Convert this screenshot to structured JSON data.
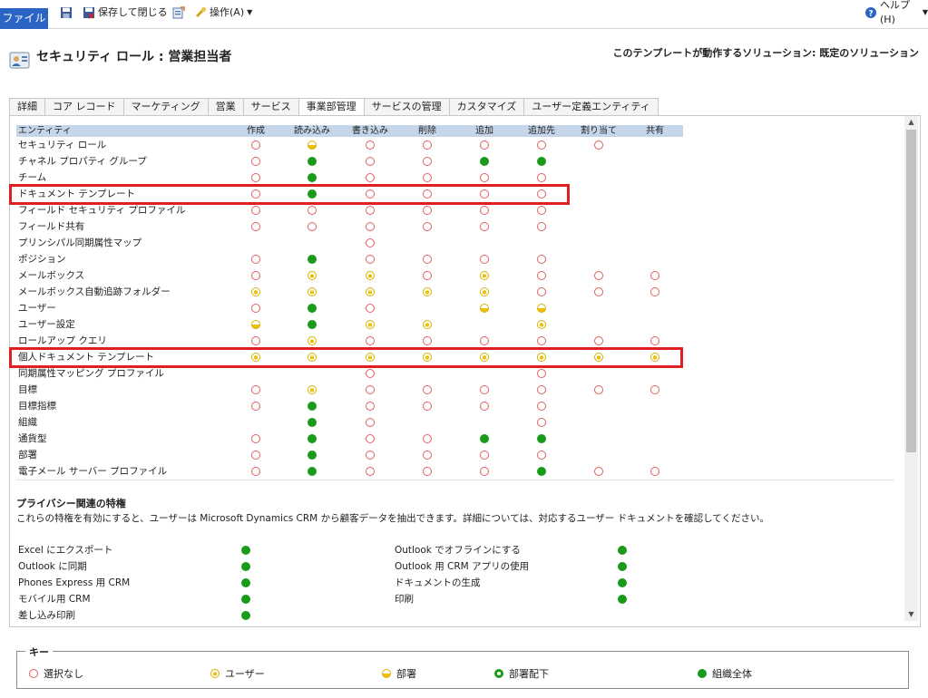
{
  "ribbon": {
    "file_label": "ファイル",
    "save_close_label": "保存して閉じる",
    "actions_label": "操作(A)",
    "help_label": "ヘルプ(H)"
  },
  "header": {
    "title": "セキュリティ ロール : 営業担当者",
    "solution": "このテンプレートが動作するソリューション: 既定のソリューション"
  },
  "tabs": [
    "詳細",
    "コア レコード",
    "マーケティング",
    "営業",
    "サービス",
    "事業部管理",
    "サービスの管理",
    "カスタマイズ",
    "ユーザー定義エンティティ"
  ],
  "active_tab": 5,
  "grid": {
    "columns": [
      "エンティティ",
      "作成",
      "読み込み",
      "書き込み",
      "削除",
      "追加",
      "追加先",
      "割り当て",
      "共有"
    ],
    "rows": [
      {
        "label": "セキュリティ ロール",
        "cells": [
          "none",
          "bu",
          "none",
          "none",
          "none",
          "none",
          "none",
          ""
        ]
      },
      {
        "label": "チャネル プロパティ グループ",
        "cells": [
          "none",
          "org",
          "none",
          "none",
          "org",
          "org",
          "",
          ""
        ]
      },
      {
        "label": "チーム",
        "cells": [
          "none",
          "org",
          "none",
          "none",
          "none",
          "none",
          "",
          ""
        ]
      },
      {
        "label": "ドキュメント テンプレート",
        "cells": [
          "none",
          "org",
          "none",
          "none",
          "none",
          "none",
          "",
          ""
        ]
      },
      {
        "label": "フィールド セキュリティ プロファイル",
        "cells": [
          "none",
          "none",
          "none",
          "none",
          "none",
          "none",
          "",
          ""
        ]
      },
      {
        "label": "フィールド共有",
        "cells": [
          "none",
          "none",
          "none",
          "none",
          "none",
          "none",
          "",
          ""
        ]
      },
      {
        "label": "プリンシパル同期属性マップ",
        "cells": [
          "",
          "",
          "none",
          "",
          "",
          "",
          "",
          ""
        ]
      },
      {
        "label": "ポジション",
        "cells": [
          "none",
          "org",
          "none",
          "none",
          "none",
          "none",
          "",
          ""
        ]
      },
      {
        "label": "メールボックス",
        "cells": [
          "none",
          "user",
          "user",
          "none",
          "user",
          "none",
          "none",
          "none"
        ]
      },
      {
        "label": "メールボックス自動追跡フォルダー",
        "cells": [
          "user",
          "user",
          "user",
          "user",
          "user",
          "none",
          "none",
          "none"
        ]
      },
      {
        "label": "ユーザー",
        "cells": [
          "none",
          "org",
          "none",
          "",
          "bu",
          "bu",
          "",
          ""
        ]
      },
      {
        "label": "ユーザー設定",
        "cells": [
          "bu",
          "org",
          "user",
          "user",
          "",
          "user",
          "",
          ""
        ]
      },
      {
        "label": "ロールアップ クエリ",
        "cells": [
          "none",
          "user",
          "none",
          "none",
          "none",
          "none",
          "none",
          "none"
        ]
      },
      {
        "label": "個人ドキュメント テンプレート",
        "cells": [
          "user",
          "user",
          "user",
          "user",
          "user",
          "user",
          "user",
          "user"
        ]
      },
      {
        "label": "同期属性マッピング プロファイル",
        "cells": [
          "",
          "",
          "none",
          "",
          "",
          "none",
          "",
          ""
        ]
      },
      {
        "label": "目標",
        "cells": [
          "none",
          "user",
          "none",
          "none",
          "none",
          "none",
          "none",
          "none"
        ]
      },
      {
        "label": "目標指標",
        "cells": [
          "none",
          "org",
          "none",
          "none",
          "none",
          "none",
          "",
          ""
        ]
      },
      {
        "label": "組織",
        "cells": [
          "",
          "org",
          "none",
          "",
          "",
          "none",
          "",
          ""
        ]
      },
      {
        "label": "通貨型",
        "cells": [
          "none",
          "org",
          "none",
          "none",
          "org",
          "org",
          "",
          ""
        ]
      },
      {
        "label": "部署",
        "cells": [
          "none",
          "org",
          "none",
          "none",
          "none",
          "none",
          "",
          ""
        ]
      },
      {
        "label": "電子メール サーバー プロファイル",
        "cells": [
          "none",
          "org",
          "none",
          "none",
          "none",
          "org",
          "none",
          "none"
        ]
      }
    ],
    "highlighted_rows": [
      3,
      13
    ]
  },
  "privacy": {
    "title": "プライバシー関連の特権",
    "description": "これらの特権を有効にすると、ユーザーは Microsoft Dynamics CRM から顧客データを抽出できます。詳細については、対応するユーザー ドキュメントを確認してください。",
    "left": [
      "Excel にエクスポート",
      "Outlook に同期",
      "Phones Express 用 CRM",
      "モバイル用 CRM",
      "差し込み印刷"
    ],
    "right": [
      "Outlook でオフラインにする",
      "Outlook 用 CRM アプリの使用",
      "ドキュメントの生成",
      "印刷"
    ]
  },
  "key": {
    "title": "キー",
    "items": [
      "選択なし",
      "ユーザー",
      "部署",
      "部署配下",
      "組織全体"
    ]
  },
  "colors": {
    "accent": "#2a64c5",
    "org_green": "#1a9a1a",
    "user_yellow": "#f0c000",
    "none_red": "#e06060",
    "highlight_red": "#e02020",
    "header_blue": "#c5d6ea"
  }
}
